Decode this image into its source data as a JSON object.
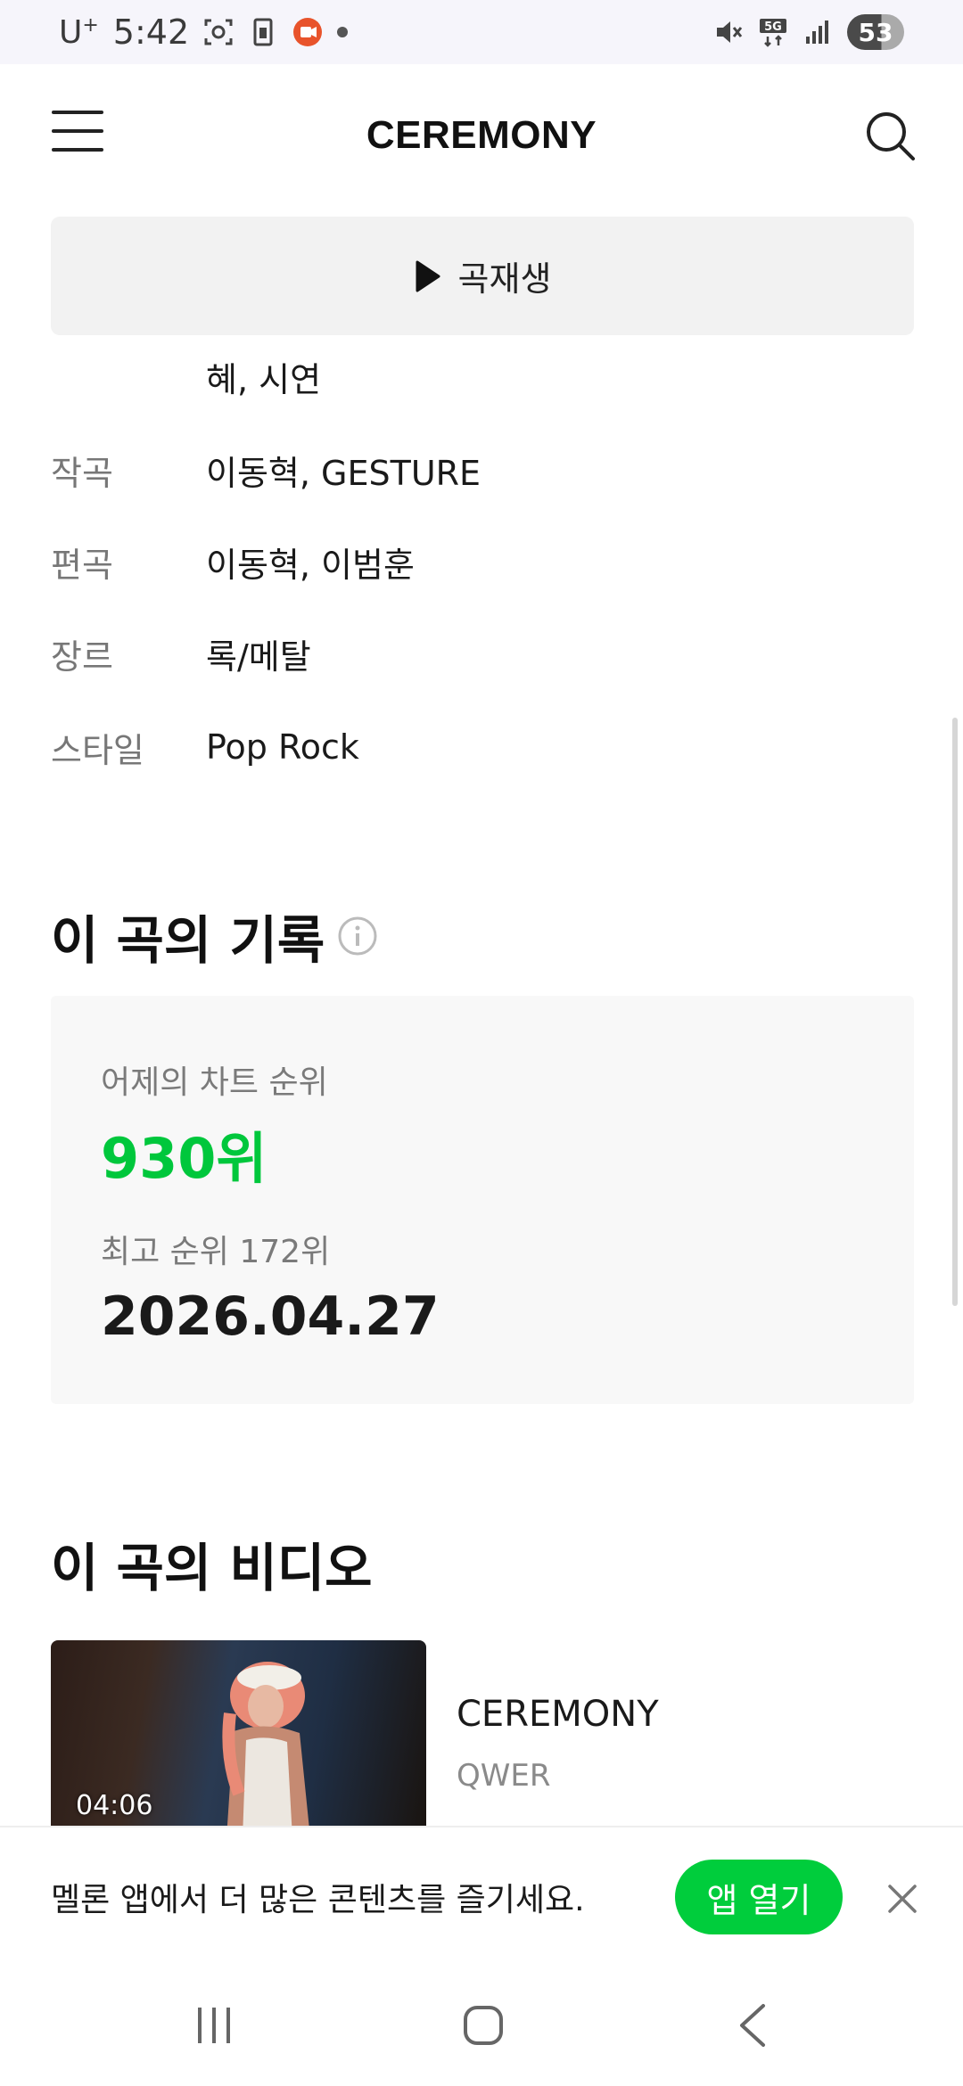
{
  "status_bar": {
    "carrier": "U",
    "carrier_sup": "+",
    "time": "5:42",
    "network": "5G",
    "battery": "53",
    "icons": [
      "screenshot-icon",
      "sim-icon",
      "recorder-icon",
      "notification-dot-icon",
      "mute-icon",
      "network-5g-icon",
      "signal-icon",
      "battery-icon"
    ]
  },
  "header": {
    "title": "CEREMONY",
    "icons": [
      "hamburger-menu-icon",
      "search-icon"
    ]
  },
  "play_bar": {
    "label": "곡재생",
    "icon": "play-icon"
  },
  "credits": {
    "partial_line": "혜, 시연",
    "rows": [
      {
        "key": "작곡",
        "value": "이동혁, GESTURE"
      },
      {
        "key": "편곡",
        "value": "이동혁, 이범훈"
      },
      {
        "key": "장르",
        "value": "록/메탈"
      },
      {
        "key": "스타일",
        "value": "Pop Rock"
      }
    ]
  },
  "record": {
    "title": "이 곡의 기록",
    "yesterday_label": "어제의 차트 순위",
    "yesterday_rank": "930위",
    "best_label": "최고 순위 172위",
    "best_date": "2026.04.27",
    "accent_color": "#00c73c"
  },
  "video": {
    "section_title": "이 곡의 비디오",
    "duration": "04:06",
    "title": "CEREMONY",
    "artist": "QWER"
  },
  "banner": {
    "text": "멜론 앱에서 더 많은 콘텐츠를 즐기세요.",
    "button_label": "앱 열기",
    "button_color": "#00cd3c"
  },
  "nav": {
    "icons": [
      "recent-apps-icon",
      "home-icon",
      "back-icon"
    ]
  }
}
